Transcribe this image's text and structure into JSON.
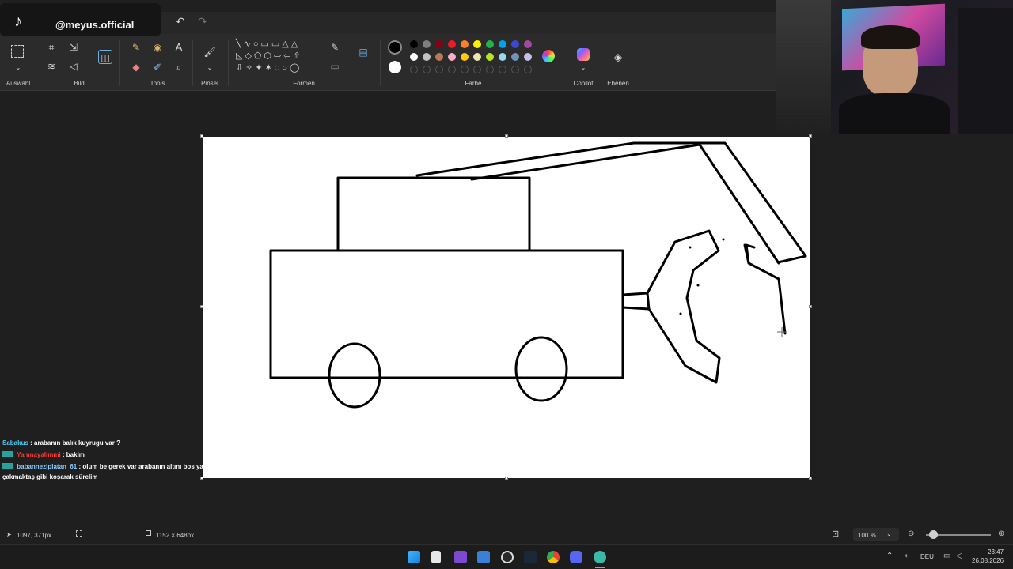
{
  "overlay": {
    "handle": "@meyus.official"
  },
  "ribbon": {
    "groups": {
      "selection": "Auswahl",
      "image": "Bild",
      "tools": "Tools",
      "brush": "Pinsel",
      "shapes": "Formen",
      "colors": "Farbe",
      "copilot": "Copilot",
      "layers": "Ebenen"
    },
    "text_tool": "A"
  },
  "palette": {
    "primary": "#000000",
    "secondary": "#ffffff",
    "row1": [
      "#000000",
      "#7f7f7f",
      "#880015",
      "#ed1c24",
      "#ff7f27",
      "#fff200",
      "#22b14c",
      "#00a2e8",
      "#3f48cc",
      "#a349a4"
    ],
    "row2": [
      "#ffffff",
      "#c3c3c3",
      "#b97a57",
      "#ffaec9",
      "#ffc90e",
      "#efe4b0",
      "#b5e61d",
      "#99d9ea",
      "#7092be",
      "#c8bfe7"
    ]
  },
  "chat": [
    {
      "user": "Sabakus",
      "user_color": "#4fd1ff",
      "message": ": arabanın balık kuyrugu var ?"
    },
    {
      "user": "Yanmayalimmi",
      "user_color": "#ff3b3b",
      "message": ": bakim"
    },
    {
      "user": "babanneziplatan_61",
      "user_color": "#8ecbff",
      "message": ": olum be gerek var arabanın altını bos yap bari"
    },
    {
      "user": "",
      "user_color": "#ffffff",
      "message": "çakmaktaş gibi koşarak sürelim"
    }
  ],
  "status": {
    "cursor_pos": "1097, 371px",
    "canvas_size": "1152 × 648px",
    "zoom": "100 %"
  },
  "tray": {
    "lang": "DEU",
    "time": "23:47",
    "date": "26.08.2026"
  }
}
